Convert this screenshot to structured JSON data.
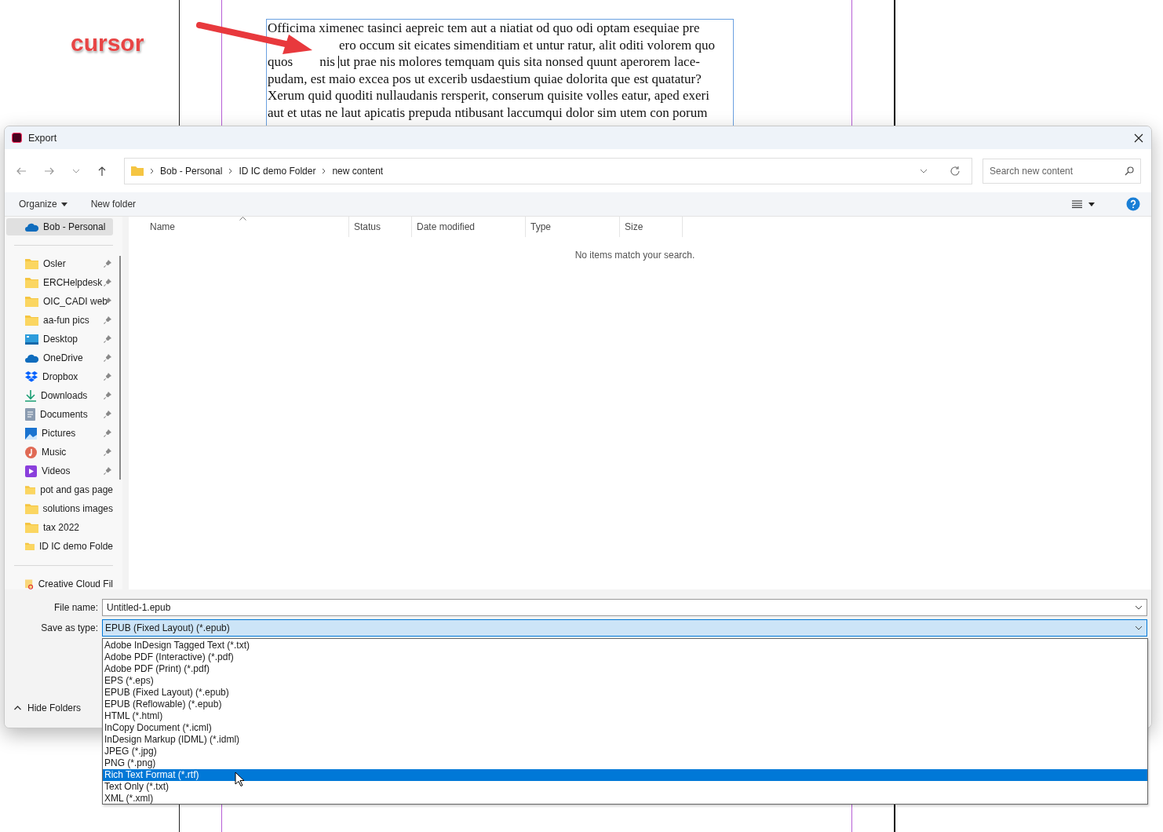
{
  "document": {
    "annotation": "cursor",
    "lines": [
      {
        "parts": [
          "Officima ximenec tasinci aepreic tem aut a niatiat od quo odi optam esequiae pre"
        ],
        "covered_start": false,
        "caret": false
      },
      {
        "parts": [
          "ero occum sit eicates simenditiam et untur ratur, alit oditi volorem quo"
        ],
        "covered_start": true,
        "caret": false
      },
      {
        "parts": [
          "quos",
          "nis",
          "ut prae nis molores temquam quis sita nonsed quunt aperorem lace-"
        ],
        "covered_start": false,
        "caret": true
      },
      {
        "parts": [
          "pudam, est maio excea pos ut excerib usdaestium quiae dolorita que est quatatur?"
        ],
        "covered_start": false,
        "caret": false
      },
      {
        "parts": [
          "Xerum quid quoditi nullaudanis rersperit, conserum quisite volles eatur, aped exeri"
        ],
        "covered_start": false,
        "caret": false
      },
      {
        "parts": [
          "aut et utas ne laut apicatis prepuda ntibusant laccumqui dolor sim utem con porum"
        ],
        "covered_start": false,
        "caret": false
      }
    ]
  },
  "dialog": {
    "title": "Export",
    "breadcrumb": [
      "Bob - Personal",
      "ID IC demo Folder",
      "new content"
    ],
    "search": {
      "placeholder": "Search new content"
    },
    "toolbar": {
      "organize": "Organize",
      "new_folder": "New folder"
    },
    "sidebar": {
      "sections": [
        {
          "items": [
            {
              "label": "Bob - Personal",
              "kind": "cloud",
              "pinned": false,
              "selected": true
            }
          ]
        },
        {
          "items": [
            {
              "label": "Osler",
              "kind": "folder",
              "pinned": true,
              "selected": false
            },
            {
              "label": "ERCHelpdesk",
              "kind": "folder",
              "pinned": true,
              "selected": false
            },
            {
              "label": "OIC_CADI web",
              "kind": "folder",
              "pinned": true,
              "selected": false
            },
            {
              "label": "aa-fun pics",
              "kind": "folder",
              "pinned": true,
              "selected": false
            },
            {
              "label": "Desktop",
              "kind": "desktop",
              "pinned": true,
              "selected": false
            },
            {
              "label": "OneDrive",
              "kind": "cloud",
              "pinned": true,
              "selected": false
            },
            {
              "label": "Dropbox",
              "kind": "dropbox",
              "pinned": true,
              "selected": false
            },
            {
              "label": "Downloads",
              "kind": "download",
              "pinned": true,
              "selected": false
            },
            {
              "label": "Documents",
              "kind": "documents",
              "pinned": true,
              "selected": false
            },
            {
              "label": "Pictures",
              "kind": "pictures",
              "pinned": true,
              "selected": false
            },
            {
              "label": "Music",
              "kind": "music",
              "pinned": true,
              "selected": false
            },
            {
              "label": "Videos",
              "kind": "videos",
              "pinned": true,
              "selected": false
            },
            {
              "label": "pot and gas page",
              "kind": "folder",
              "pinned": false,
              "selected": false
            },
            {
              "label": "solutions images",
              "kind": "folder",
              "pinned": false,
              "selected": false
            },
            {
              "label": "tax 2022",
              "kind": "folder",
              "pinned": false,
              "selected": false
            },
            {
              "label": "ID IC demo Folde",
              "kind": "folder",
              "pinned": false,
              "selected": false
            }
          ]
        },
        {
          "items": [
            {
              "label": "Creative Cloud Fil",
              "kind": "creative-cloud",
              "pinned": false,
              "selected": false
            }
          ]
        }
      ]
    },
    "columns": [
      "Name",
      "Status",
      "Date modified",
      "Type",
      "Size"
    ],
    "empty_message": "No items match your search.",
    "file_name": {
      "label": "File name:",
      "value": "Untitled-1.epub"
    },
    "save_as_type": {
      "label": "Save as type:",
      "value": "EPUB (Fixed Layout) (*.epub)"
    },
    "type_options": [
      {
        "label": "Adobe InDesign Tagged Text (*.txt)",
        "selected": false
      },
      {
        "label": "Adobe PDF (Interactive) (*.pdf)",
        "selected": false
      },
      {
        "label": "Adobe PDF (Print) (*.pdf)",
        "selected": false
      },
      {
        "label": "EPS (*.eps)",
        "selected": false
      },
      {
        "label": "EPUB (Fixed Layout) (*.epub)",
        "selected": false
      },
      {
        "label": "EPUB (Reflowable) (*.epub)",
        "selected": false
      },
      {
        "label": "HTML (*.html)",
        "selected": false
      },
      {
        "label": "InCopy Document (*.icml)",
        "selected": false
      },
      {
        "label": "InDesign Markup (IDML) (*.idml)",
        "selected": false
      },
      {
        "label": "JPEG (*.jpg)",
        "selected": false
      },
      {
        "label": "PNG (*.png)",
        "selected": false
      },
      {
        "label": "Rich Text Format (*.rtf)",
        "selected": true
      },
      {
        "label": "Text Only (*.txt)",
        "selected": false
      },
      {
        "label": "XML (*.xml)",
        "selected": false
      }
    ],
    "hide_folders": "Hide Folders"
  }
}
